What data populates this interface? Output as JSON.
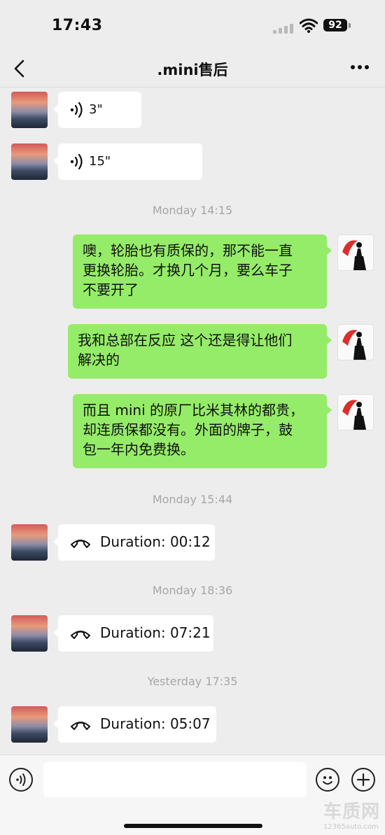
{
  "status_bar": {
    "time": "17:43",
    "battery": "92"
  },
  "header": {
    "title": ".mini售后"
  },
  "messages": {
    "voice1": {
      "duration": "3\""
    },
    "voice2": {
      "duration": "15\""
    },
    "time1": "Monday 14:15",
    "out1": {
      "lines": [
        "噢，轮胎也有质保的，那不能一直",
        "更换轮胎。才换几个月，要么车子",
        "不要开了"
      ]
    },
    "out2": {
      "lines": [
        "我和总部在反应 这个还是得让他们",
        "解决的"
      ]
    },
    "out3": {
      "lines": [
        "而且 mini 的原厂比米其林的都贵，",
        "却连质保都没有。外面的牌子，鼓",
        "包一年内免费换。"
      ]
    },
    "time2": "Monday 15:44",
    "call1": {
      "label": "Duration: 00:12"
    },
    "time3": "Monday 18:36",
    "call2": {
      "label": "Duration: 07:21"
    },
    "time4": "Yesterday 17:35",
    "call3": {
      "label": "Duration: 05:07"
    }
  },
  "watermark": {
    "main": "车质网",
    "sub": "12365auto.com"
  },
  "colors": {
    "sent_bubble": "#95ec69",
    "received_bubble": "#ffffff",
    "background": "#ededed"
  },
  "icons": [
    "back-icon",
    "more-icon",
    "voice-icon",
    "phone-icon",
    "voice-input-icon",
    "emoji-icon",
    "plus-icon"
  ]
}
